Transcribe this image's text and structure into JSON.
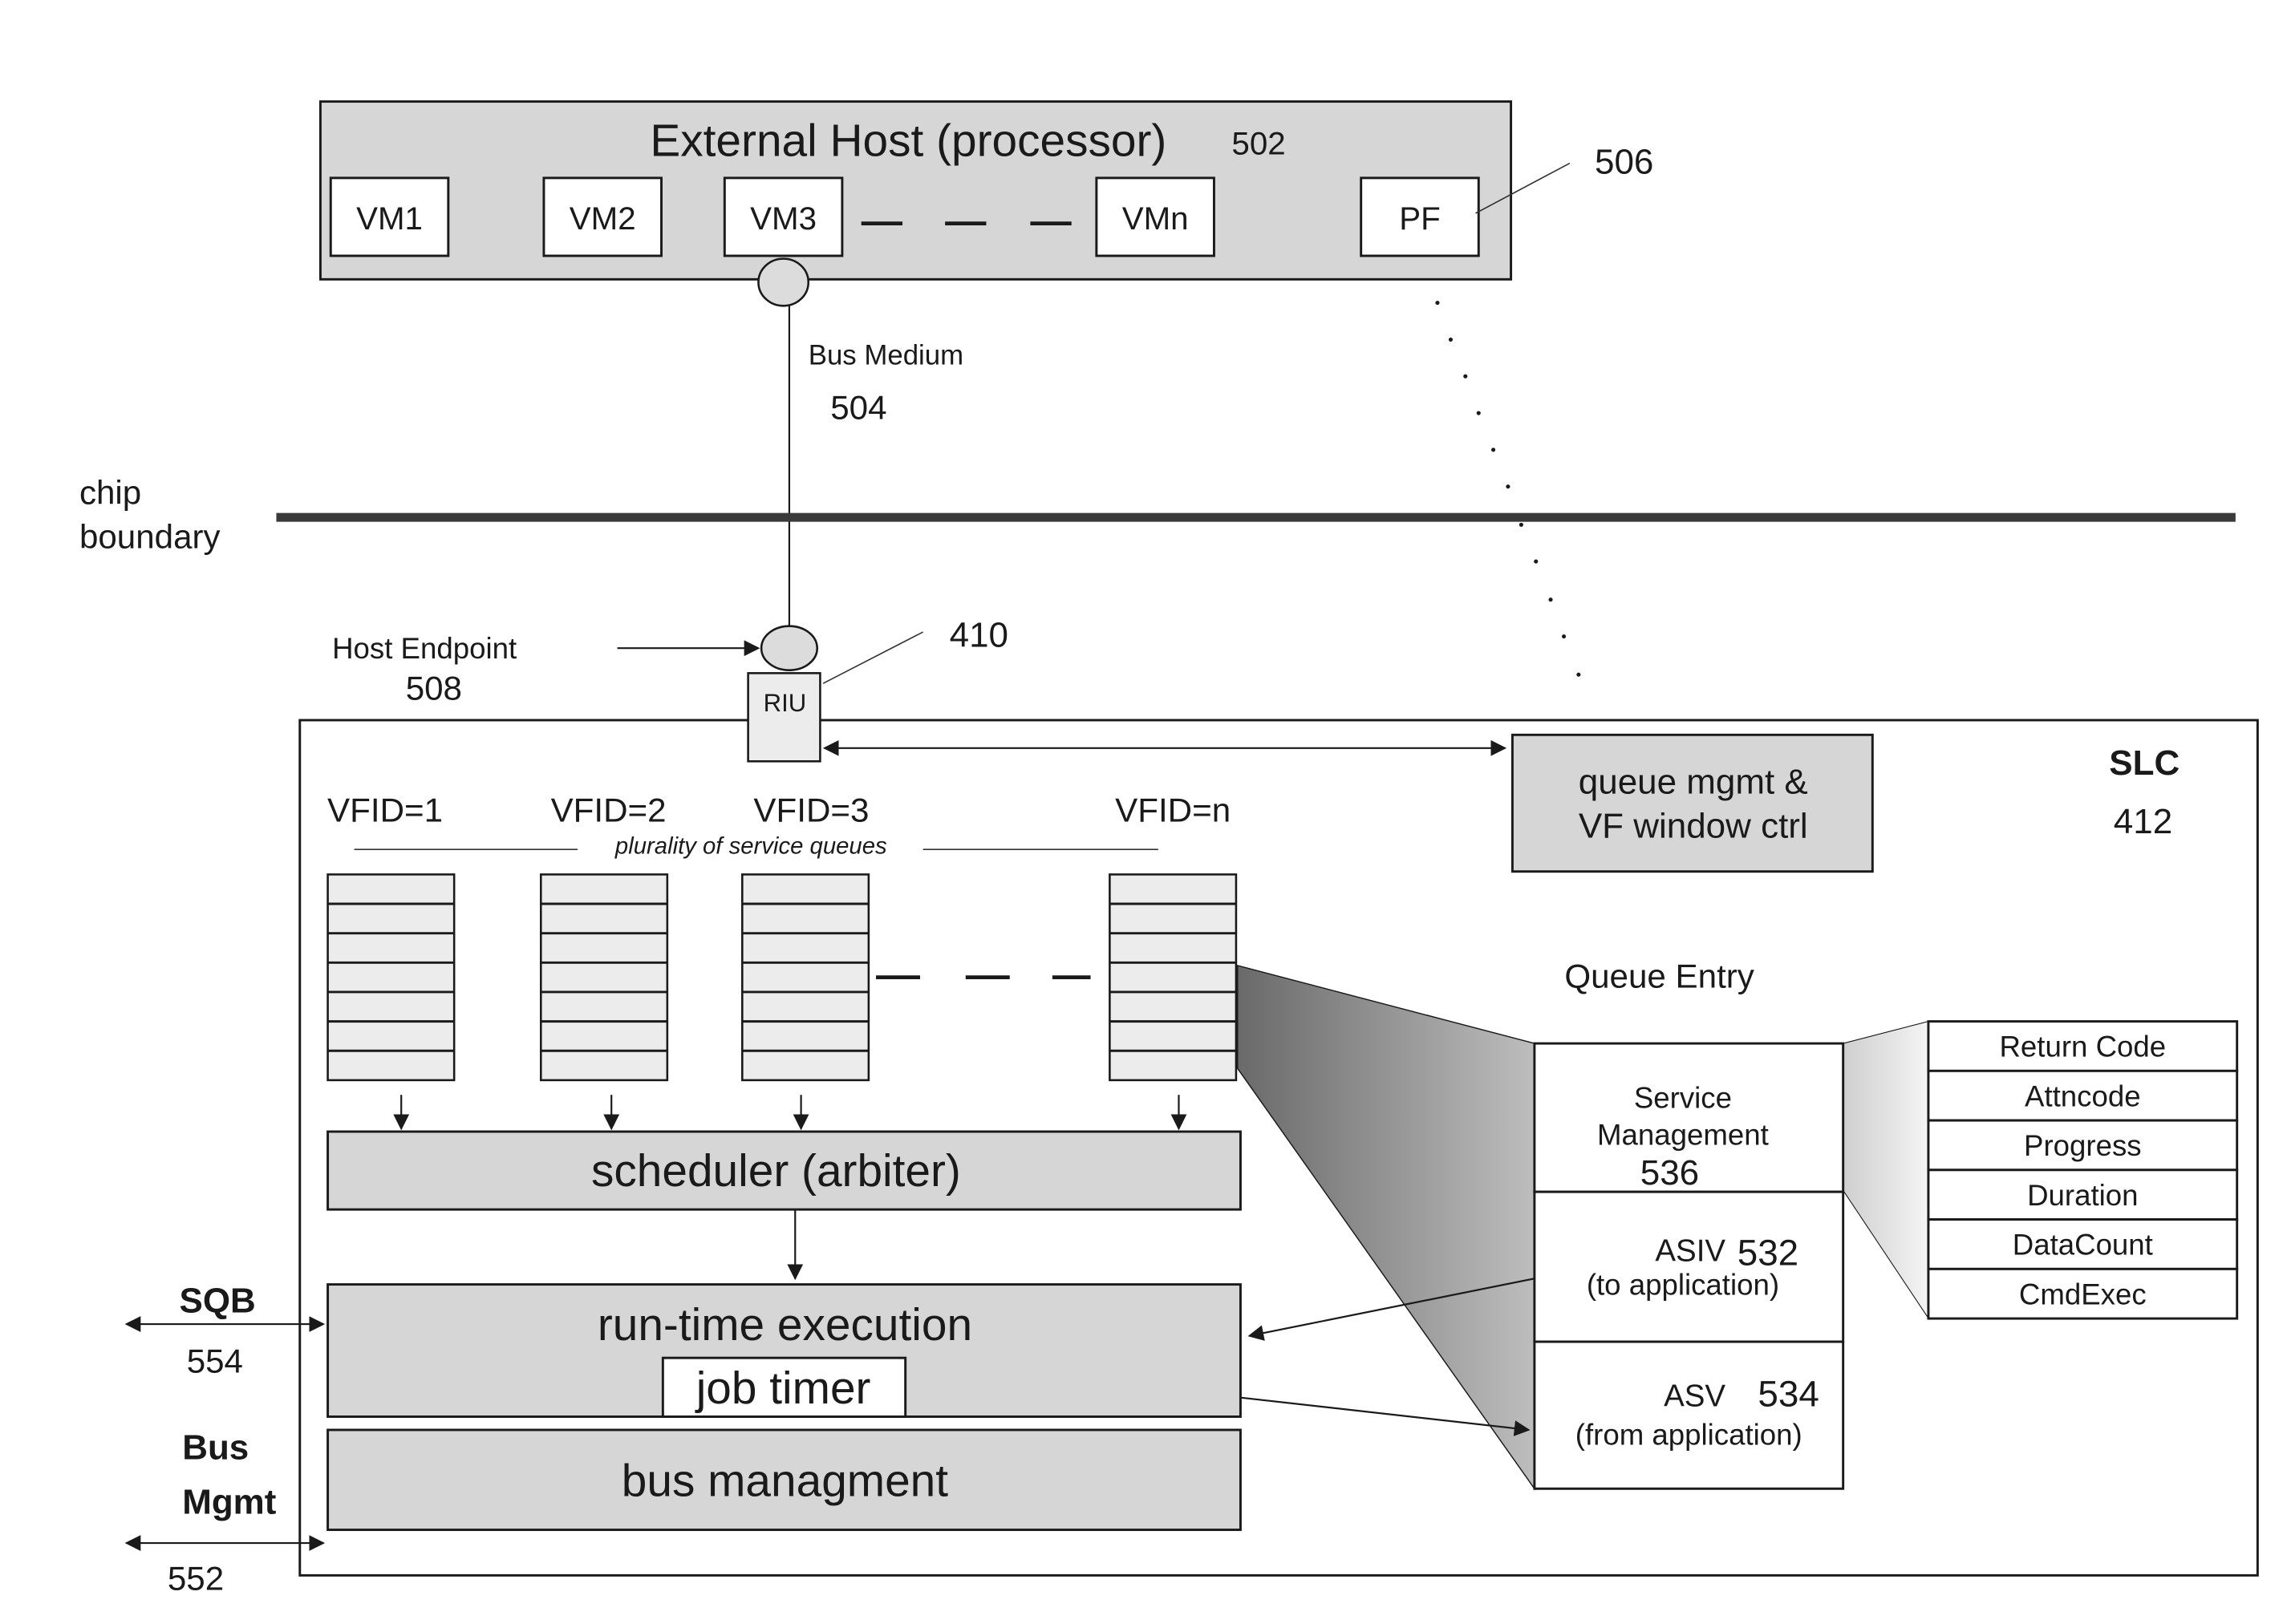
{
  "external_host": {
    "title": "External Host (processor)",
    "ref": "502",
    "vms": [
      "VM1",
      "VM2",
      "VM3",
      "VMn"
    ],
    "pf_label": "PF",
    "pf_ref": "506"
  },
  "bus_medium": {
    "label": "Bus Medium",
    "ref": "504"
  },
  "chip_boundary": {
    "line1": "chip",
    "line2": "boundary"
  },
  "host_endpoint": {
    "label": "Host Endpoint",
    "ref": "508"
  },
  "riu": {
    "label": "RIU",
    "ref": "410"
  },
  "slc": {
    "label": "SLC",
    "ref": "412"
  },
  "queue_mgmt": {
    "line1": "queue mgmt &",
    "line2": "VF window ctrl"
  },
  "queues": {
    "caption": "plurality of service queues",
    "labels": [
      "VFID=1",
      "VFID=2",
      "VFID=3",
      "VFID=n"
    ],
    "slots_per_queue": 7
  },
  "scheduler": {
    "label": "scheduler (arbiter)"
  },
  "runtime": {
    "label": "run-time execution",
    "job_timer": "job timer"
  },
  "bus_mgmt_block": {
    "label": "bus managment"
  },
  "sqb": {
    "label": "SQB",
    "ref": "554"
  },
  "bus_mgmt_side": {
    "line1": "Bus",
    "line2": "Mgmt",
    "ref": "552"
  },
  "queue_entry": {
    "title": "Queue Entry",
    "service_mgmt": {
      "line1": "Service",
      "line2": "Management",
      "ref": "536"
    },
    "asiv": {
      "label": "ASIV",
      "ref": "532",
      "sub": "(to application)"
    },
    "asv": {
      "label": "ASV",
      "ref": "534",
      "sub": "(from application)"
    }
  },
  "service_fields": [
    "Return Code",
    "Attncode",
    "Progress",
    "Duration",
    "DataCount",
    "CmdExec"
  ]
}
